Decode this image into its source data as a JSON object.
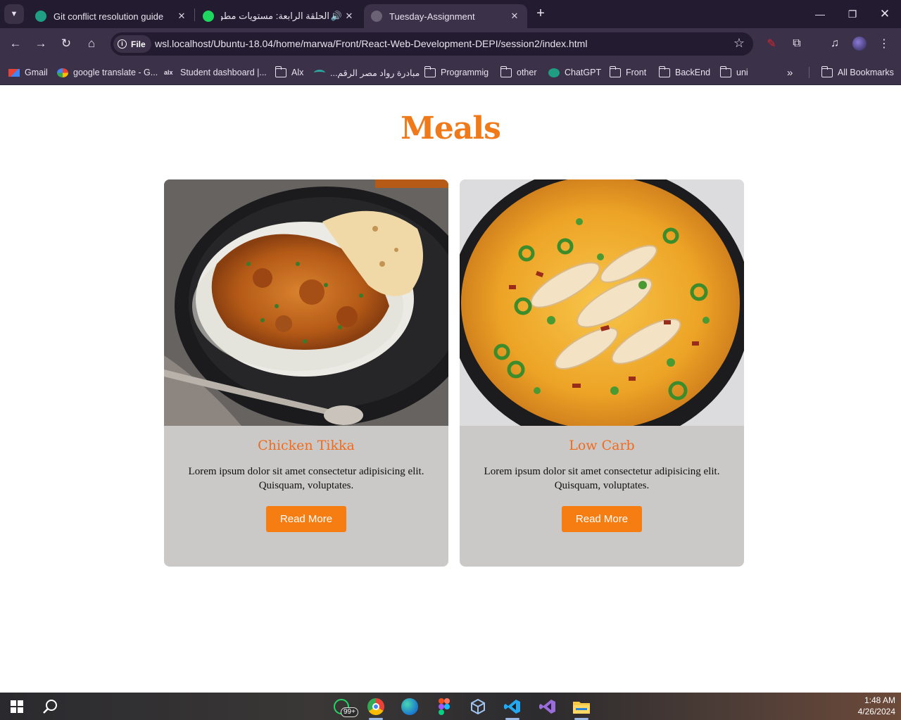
{
  "browser": {
    "tabs": [
      {
        "title": "Git conflict resolution guide",
        "active": false
      },
      {
        "title": "الحلقة الرابعة: مستويات مطو",
        "active": false
      },
      {
        "title": "Tuesday-Assignment",
        "active": true
      }
    ],
    "address": {
      "scheme_label": "File",
      "url": "wsl.localhost/Ubuntu-18.04/home/marwa/Front/React-Web-Development-DEPI/session2/index.html"
    },
    "bookmarks": [
      {
        "label": "Gmail",
        "icon": "gmail-icon"
      },
      {
        "label": "google translate - G...",
        "icon": "google-icon"
      },
      {
        "label": "Student dashboard |...",
        "icon": "alx-icon"
      },
      {
        "label": "Alx",
        "icon": "folder-icon"
      },
      {
        "label": "مبادرة رواد مصر الرقم...",
        "icon": "rowad-icon"
      },
      {
        "label": "Programmig",
        "icon": "folder-icon"
      },
      {
        "label": "other",
        "icon": "folder-icon"
      },
      {
        "label": "ChatGPT",
        "icon": "chatgpt-icon"
      },
      {
        "label": "Front",
        "icon": "folder-icon"
      },
      {
        "label": "BackEnd",
        "icon": "folder-icon"
      },
      {
        "label": "uni",
        "icon": "folder-icon"
      }
    ],
    "overflow_label": "»",
    "all_bookmarks": "All Bookmarks"
  },
  "page": {
    "heading": "Meals",
    "cards": [
      {
        "title": "Chicken Tikka",
        "text": "Lorem ipsum dolor sit amet consectetur adipisicing elit. Quisquam, voluptates.",
        "button": "Read More",
        "image": "chicken-tikka-photo"
      },
      {
        "title": "Low Carb",
        "text": "Lorem ipsum dolor sit amet consectetur adipisicing elit. Quisquam, voluptates.",
        "button": "Read More",
        "image": "low-carb-skillet-photo"
      }
    ]
  },
  "taskbar": {
    "whatsapp_badge": "99+",
    "time": "1:48 AM",
    "date": "4/26/2024"
  },
  "colors": {
    "accent": "#f07a1a",
    "card_bg": "#cbc8c8",
    "button_bg": "#f57d12",
    "chrome_dark": "#231c30",
    "chrome_toolbar": "#3b3148"
  }
}
